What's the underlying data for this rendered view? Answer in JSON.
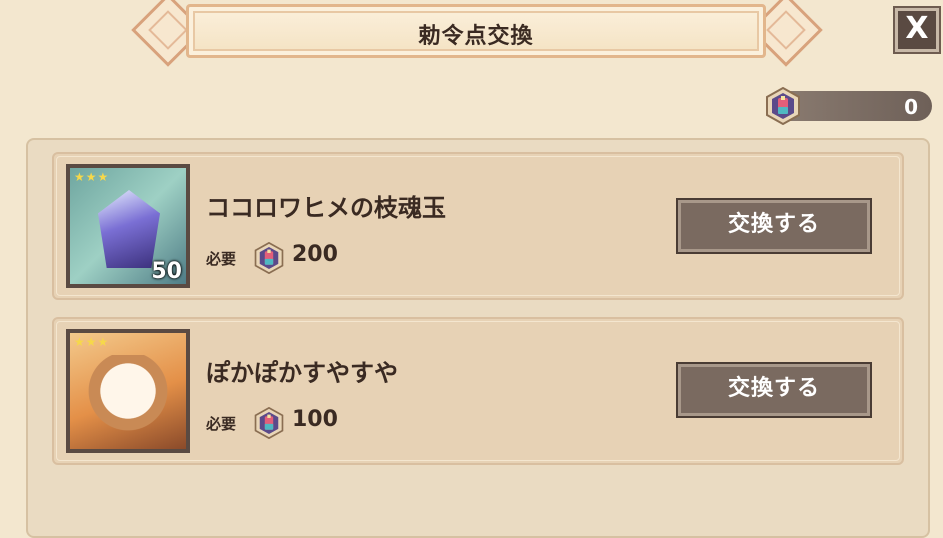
{
  "header": {
    "title": "勅令点交換",
    "close_label": "X"
  },
  "currency": {
    "icon": "edict-token-icon",
    "amount": "0"
  },
  "items": [
    {
      "name": "ココロワヒメの枝魂玉",
      "stars": "★★★",
      "quantity": "50",
      "required_label": "必要",
      "required_amount": "200",
      "button_label": "交換する"
    },
    {
      "name": "ぽかぽかすやすや",
      "stars": "★★★",
      "quantity": "",
      "required_label": "必要",
      "required_amount": "100",
      "button_label": "交換する"
    }
  ],
  "colors": {
    "background": "#f3e7cf",
    "button": "#7a6a60",
    "accent": "#d8a27c"
  }
}
